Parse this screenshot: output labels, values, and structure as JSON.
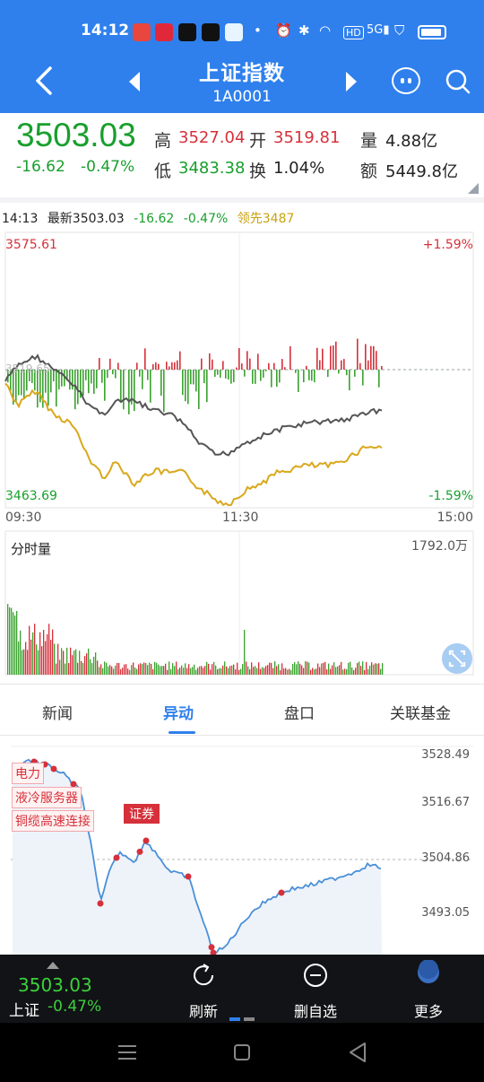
{
  "status_bar": {
    "time": "14:12",
    "icons": [
      "app-icon",
      "app-icon",
      "tiktok-icon",
      "tiktok-icon",
      "app-icon",
      "dot-icon",
      "alarm-icon",
      "bluetooth-icon",
      "wifi-icon",
      "hd-icon",
      "signal-5g-icon",
      "shield-icon",
      "battery-icon"
    ]
  },
  "header": {
    "title": "上证指数",
    "code": "1A0001"
  },
  "quote": {
    "price": "3503.03",
    "change": "-16.62",
    "change_pct": "-0.47%",
    "high_label": "高",
    "high": "3527.04",
    "open_label": "开",
    "open": "3519.81",
    "volume_label": "量",
    "volume": "4.88亿",
    "low_label": "低",
    "low": "3483.38",
    "turnover_label": "换",
    "turnover": "1.04%",
    "amount_label": "额",
    "amount": "5449.8亿"
  },
  "info_bar": {
    "time": "14:13",
    "latest": "最新3503.03",
    "change": "-16.62",
    "change_pct": "-0.47%",
    "leading": "领先3487"
  },
  "intraday_chart": {
    "top_value": "3575.61",
    "top_pct": "+1.59%",
    "bottom_value": "3463.69",
    "bottom_pct": "-1.59%",
    "mid_value": "3519.65",
    "time_start": "09:30",
    "time_mid": "11:30",
    "time_end": "15:00",
    "volume_title": "分时量",
    "volume_max": "1792.0万"
  },
  "tabs": [
    "新闻",
    "异动",
    "盘口",
    "关联基金"
  ],
  "active_tab": 1,
  "anomaly_chart": {
    "levels": [
      "3528.49",
      "3516.67",
      "3504.86",
      "3493.05"
    ],
    "tags": [
      "电力",
      "液冷服务器",
      "铜缆高速连接"
    ],
    "highlight_tag": "证券"
  },
  "toolbar": {
    "price": "3503.03",
    "name": "上证",
    "pct": "-0.47%",
    "refresh_label": "刷新",
    "remove_label": "删自选",
    "more_label": "更多"
  },
  "colors": {
    "header_blue": "#2f80ed",
    "up_red": "#d6303a",
    "down_green": "#189f2c",
    "leading_orange": "#c9a20f",
    "toolbar_bg": "#121316"
  }
}
